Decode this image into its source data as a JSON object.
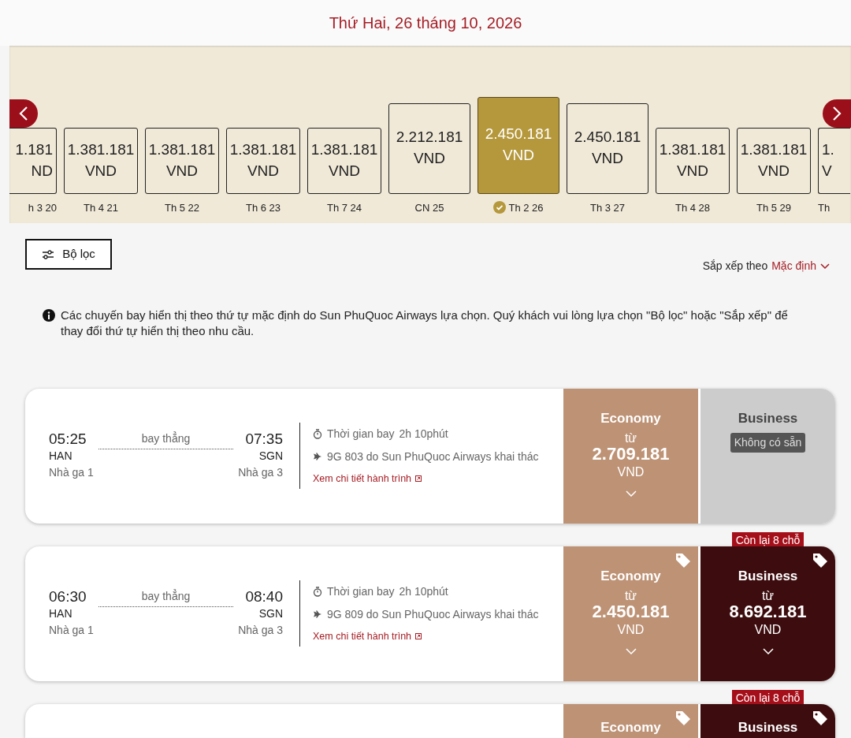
{
  "header": {
    "title": "Thứ Hai, 26 tháng 10, 2026"
  },
  "date_strip": {
    "days": [
      {
        "price": "1.181",
        "currency": "ND",
        "label": "h 3 20",
        "kind": "low",
        "selected": false,
        "cut_left": true
      },
      {
        "price": "1.381.181",
        "currency": "VND",
        "label": "Th 4 21",
        "kind": "low",
        "selected": false
      },
      {
        "price": "1.381.181",
        "currency": "VND",
        "label": "Th 5 22",
        "kind": "low",
        "selected": false
      },
      {
        "price": "1.381.181",
        "currency": "VND",
        "label": "Th 6 23",
        "kind": "low",
        "selected": false
      },
      {
        "price": "1.381.181",
        "currency": "VND",
        "label": "Th 7 24",
        "kind": "low",
        "selected": false
      },
      {
        "price": "2.212.181",
        "currency": "VND",
        "label": "CN 25",
        "kind": "high",
        "selected": false
      },
      {
        "price": "2.450.181",
        "currency": "VND",
        "label": "Th 2 26",
        "kind": "high",
        "selected": true
      },
      {
        "price": "2.450.181",
        "currency": "VND",
        "label": "Th 3 27",
        "kind": "high",
        "selected": false
      },
      {
        "price": "1.381.181",
        "currency": "VND",
        "label": "Th 4 28",
        "kind": "low",
        "selected": false
      },
      {
        "price": "1.381.181",
        "currency": "VND",
        "label": "Th 5 29",
        "kind": "low",
        "selected": false
      },
      {
        "price": "1.",
        "currency": "V",
        "label": "Th",
        "kind": "low",
        "selected": false,
        "cut_right": true
      }
    ]
  },
  "filter": {
    "label": "Bộ lọc"
  },
  "sort": {
    "label": "Sắp xếp theo",
    "value": "Mặc định"
  },
  "notice": "Các chuyến bay hiển thị theo thứ tự mặc định do Sun PhuQuoc Airways lựa chọn. Quý khách vui lòng lựa chọn \"Bộ lọc\" hoặc \"Sắp xếp\" để thay đổi thứ tự hiển thị theo nhu cầu.",
  "flights": [
    {
      "departure": {
        "time": "05:25",
        "airport": "HAN",
        "terminal": "Nhà ga 1"
      },
      "stops": "bay thẳng",
      "arrival": {
        "time": "07:35",
        "airport": "SGN",
        "terminal": "Nhà ga 3"
      },
      "duration_label": "Thời gian bay",
      "duration": "2h 10phút",
      "flight": "9G 803 do Sun PhuQuoc Airways khai thác",
      "details_link": "Xem chi tiết hành trình",
      "fares": [
        {
          "kind": "economy",
          "class": "Economy",
          "available": true,
          "tagged": false,
          "from": "từ",
          "price": "2.709.181",
          "currency": "VND"
        },
        {
          "kind": "business",
          "class": "Business",
          "available": false,
          "tagged": false,
          "status": "Không có sẵn"
        }
      ]
    },
    {
      "departure": {
        "time": "06:30",
        "airport": "HAN",
        "terminal": "Nhà ga 1"
      },
      "stops": "bay thẳng",
      "arrival": {
        "time": "08:40",
        "airport": "SGN",
        "terminal": "Nhà ga 3"
      },
      "duration_label": "Thời gian bay",
      "duration": "2h 10phút",
      "flight": "9G 809 do Sun PhuQuoc Airways khai thác",
      "details_link": "Xem chi tiết hành trình",
      "fares": [
        {
          "kind": "economy",
          "class": "Economy",
          "available": true,
          "tagged": true,
          "from": "từ",
          "price": "2.450.181",
          "currency": "VND"
        },
        {
          "kind": "business",
          "class": "Business",
          "available": true,
          "tagged": true,
          "seats_left": "Còn lại 8 chỗ",
          "from": "từ",
          "price": "8.692.181",
          "currency": "VND"
        }
      ]
    },
    {
      "fares": [
        {
          "kind": "economy",
          "class": "Economy",
          "available": true,
          "tagged": true
        },
        {
          "kind": "business",
          "class": "Business",
          "available": true,
          "tagged": true,
          "seats_left": "Còn lại 8 chỗ"
        }
      ]
    }
  ]
}
